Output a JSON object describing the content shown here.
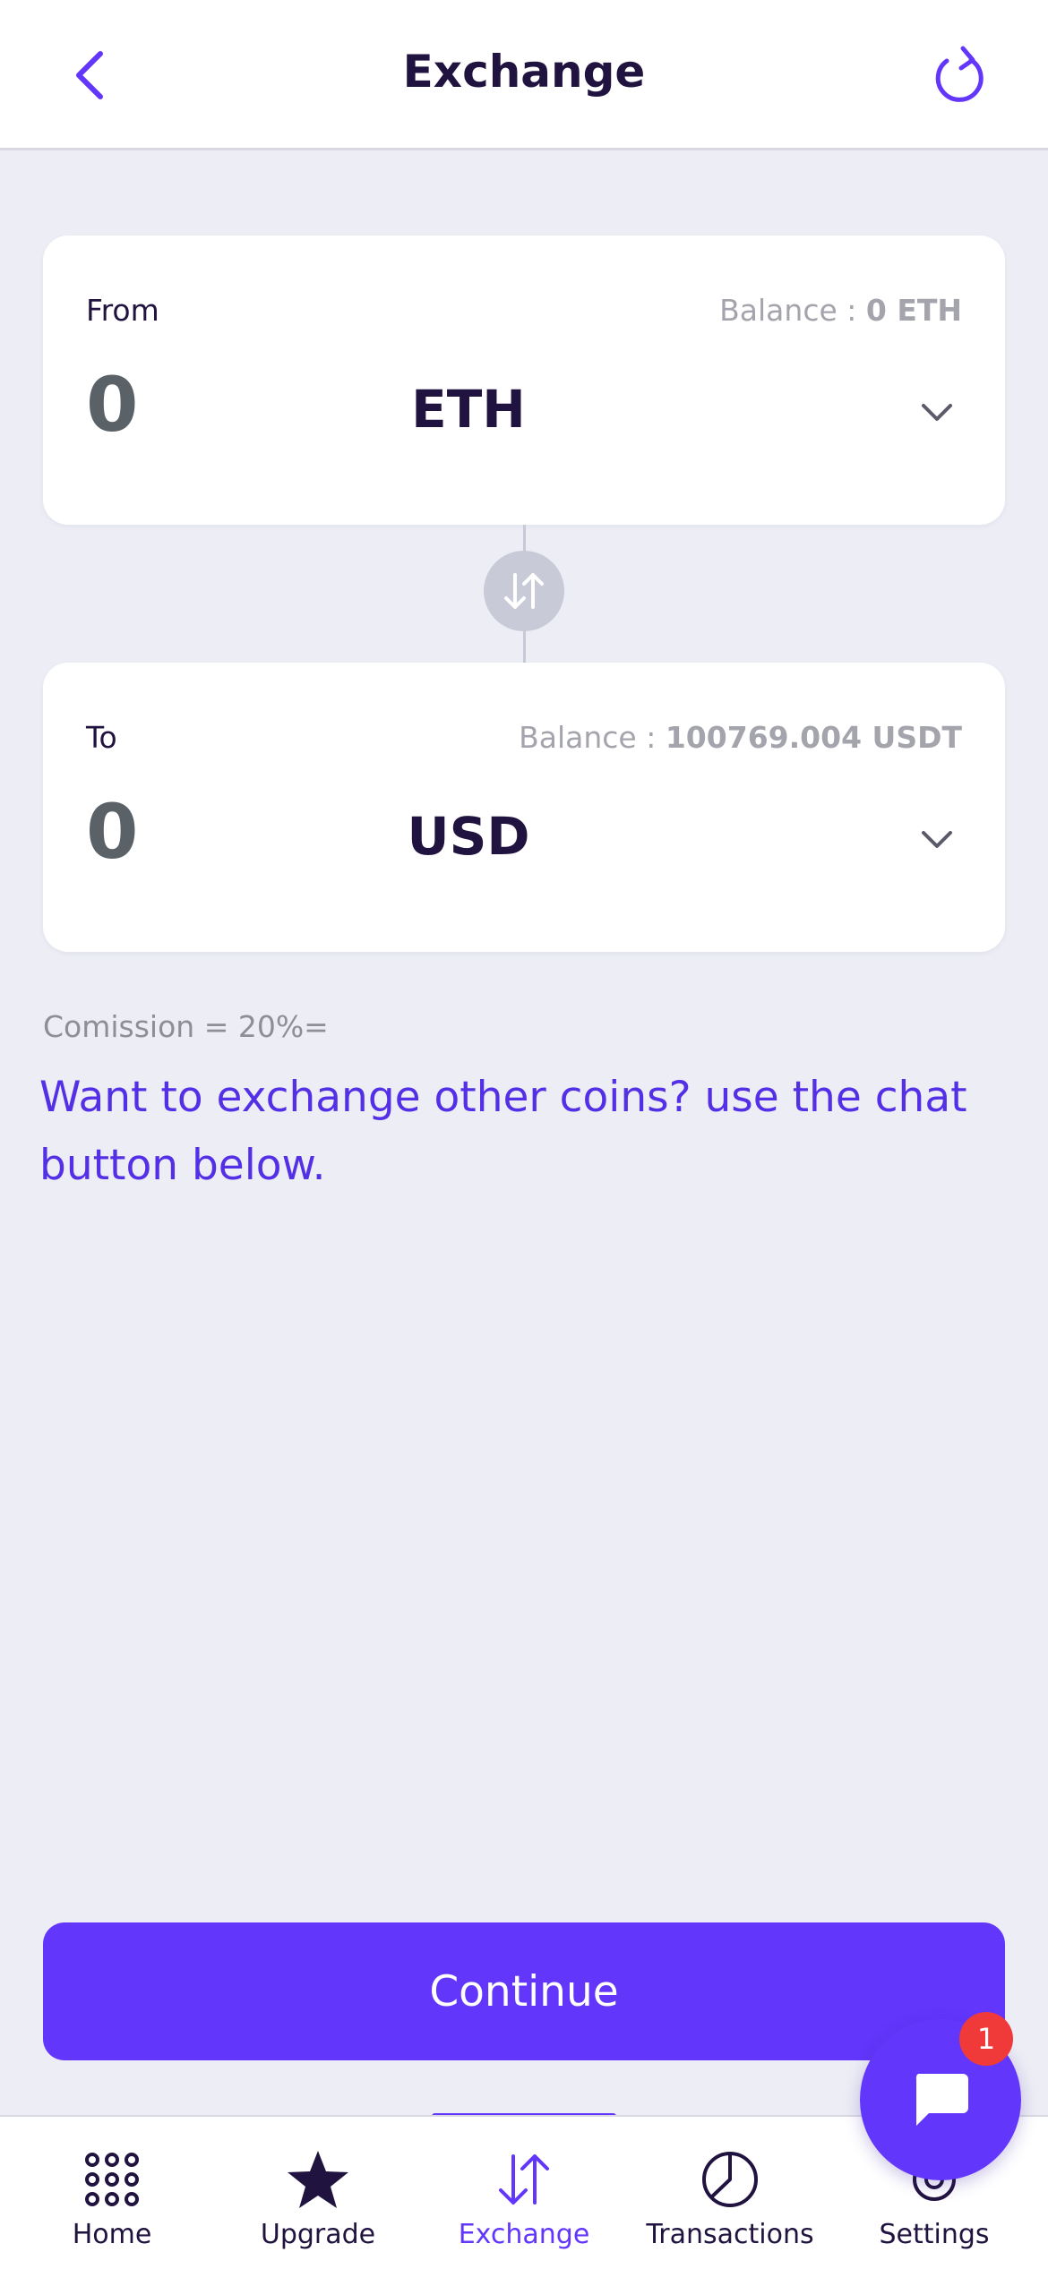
{
  "header": {
    "title": "Exchange",
    "back_icon": "chevron-left-icon",
    "refresh_icon": "refresh-icon"
  },
  "from_card": {
    "label": "From",
    "balance_label": "Balance : ",
    "balance_value": "0 ETH",
    "amount": "0",
    "currency": "ETH"
  },
  "to_card": {
    "label": "To",
    "balance_label": "Balance : ",
    "balance_value": "100769.004 USDT",
    "amount": "0",
    "currency": "USD"
  },
  "commission": "Comission = 20%=",
  "note": "Want to exchange other coins? use the chat button below.",
  "continue_label": "Continue",
  "nav": {
    "items": [
      {
        "label": "Home",
        "icon": "grid-dots-icon"
      },
      {
        "label": "Upgrade",
        "icon": "star-icon"
      },
      {
        "label": "Exchange",
        "icon": "swap-arrows-icon",
        "active": true
      },
      {
        "label": "Transactions",
        "icon": "pie-chart-icon"
      },
      {
        "label": "Settings",
        "icon": "gear-icon"
      }
    ]
  },
  "chat": {
    "badge": "1",
    "icon": "chat-bubble-icon"
  },
  "colors": {
    "accent": "#6236fb",
    "background": "#ecedf5",
    "text_dark": "#21133f",
    "badge": "#f03a3a"
  }
}
